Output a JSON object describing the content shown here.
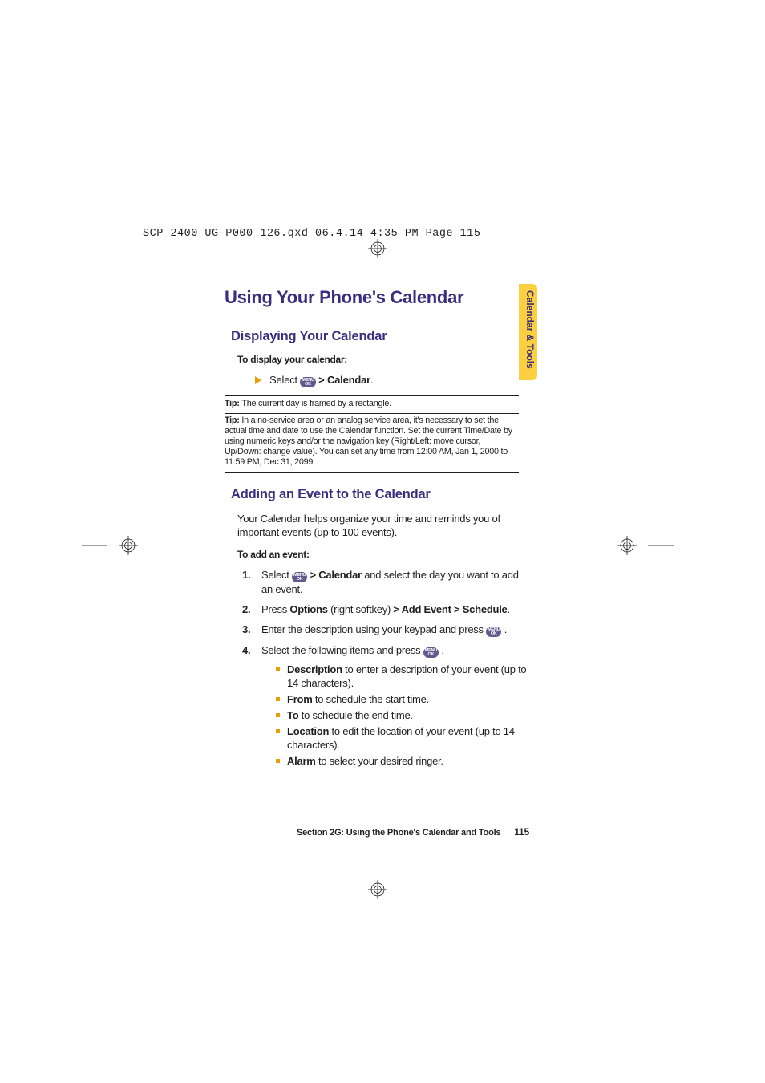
{
  "header": {
    "jobline": "SCP_2400 UG-P000_126.qxd  06.4.14  4:35 PM  Page 115"
  },
  "side_tab": "Calendar & Tools",
  "title": "Using Your Phone's Calendar",
  "section1": {
    "heading": "Displaying Your Calendar",
    "lead": "To display your calendar:",
    "action_prefix": "Select ",
    "action_suffix_bold": " > Calendar",
    "action_end": "."
  },
  "tips": {
    "tip1_label": "Tip: ",
    "tip1_body": "The current day is framed by a rectangle.",
    "tip2_label": "Tip: ",
    "tip2_body": "In a no-service area or an analog service area, it's necessary to set the actual time and date to use the Calendar function. Set the current Time/Date by using numeric keys and/or the navigation key (Right/Left: move cursor, Up/Down: change value). You can set any time from 12:00 AM, Jan 1, 2000 to 11:59 PM, Dec 31, 2099."
  },
  "section2": {
    "heading": "Adding an Event to the Calendar",
    "intro": "Your Calendar helps organize your time and reminds you of important events (up to 100 events).",
    "lead": "To add an event:",
    "steps": [
      {
        "pre": "Select ",
        "mid_bold": " > Calendar",
        "post": " and select the day you want to add an event."
      },
      {
        "pre": "Press ",
        "b1": "Options",
        "mid1": " (right softkey) ",
        "b2": "> Add Event > Schedule",
        "post": "."
      },
      {
        "pre": "Enter the description using your keypad and press ",
        "post": " ."
      },
      {
        "pre": "Select the following items and press ",
        "post": " ."
      }
    ],
    "bullets": [
      {
        "b": "Description",
        "t": " to enter a description of your event (up to 14 characters)."
      },
      {
        "b": "From",
        "t": " to schedule the start time."
      },
      {
        "b": "To",
        "t": " to schedule the end time."
      },
      {
        "b": "Location",
        "t": " to edit the location of your event (up to 14 characters)."
      },
      {
        "b": "Alarm",
        "t": " to select your desired ringer."
      }
    ]
  },
  "footer": {
    "section": "Section 2G: Using the Phone's Calendar and Tools",
    "page": "115"
  }
}
